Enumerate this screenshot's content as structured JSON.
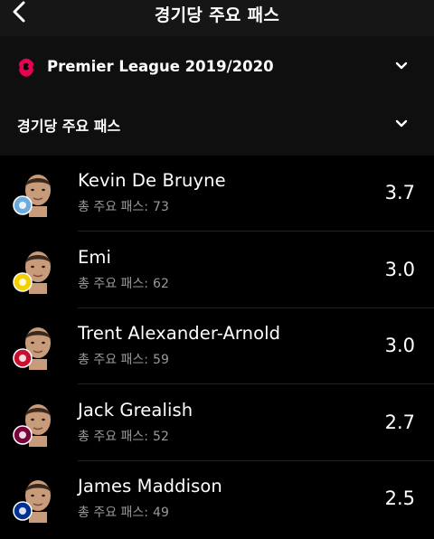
{
  "header": {
    "title": "경기당 주요 패스"
  },
  "league": {
    "name": "Premier League 2019/2020",
    "badge_icon": "premier-league-lion-icon"
  },
  "category": {
    "label": "경기당 주요 패스"
  },
  "stat_label": "총 주요 패스:",
  "players": [
    {
      "name": "Kevin De Bruyne",
      "count": "73",
      "rating": "3.7",
      "club": "manchester-city",
      "club_color": "#6CABDD"
    },
    {
      "name": "Emi",
      "count": "62",
      "rating": "3.0",
      "club": "norwich-city",
      "club_color": "#F5D000"
    },
    {
      "name": "Trent Alexander-Arnold",
      "count": "59",
      "rating": "3.0",
      "club": "liverpool",
      "club_color": "#C8102E"
    },
    {
      "name": "Jack Grealish",
      "count": "52",
      "rating": "2.7",
      "club": "aston-villa",
      "club_color": "#7A003C"
    },
    {
      "name": "James Maddison",
      "count": "49",
      "rating": "2.5",
      "club": "leicester-city",
      "club_color": "#003090"
    }
  ],
  "colors": {
    "background": "#000000",
    "header": "#161616",
    "accent": "#E90052"
  }
}
